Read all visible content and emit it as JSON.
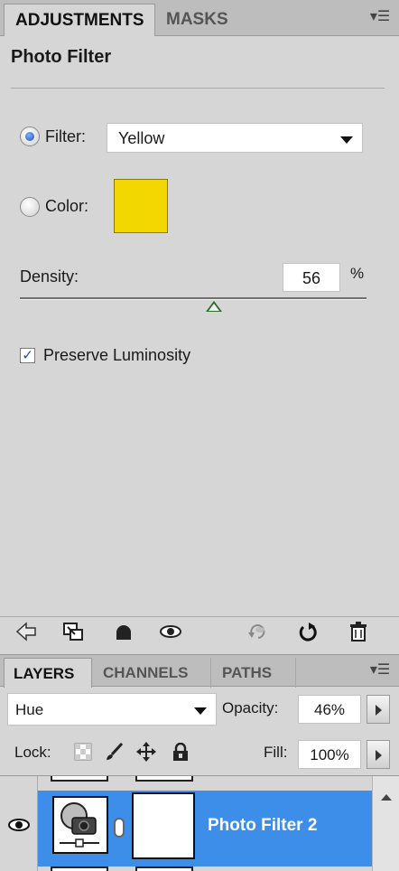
{
  "adjustments_panel": {
    "tabs": [
      {
        "label": "ADJUSTMENTS",
        "active": true
      },
      {
        "label": "MASKS",
        "active": false
      }
    ],
    "menu_icon": "panel-menu-icon",
    "title": "Photo Filter",
    "filter": {
      "radio_label": "Filter:",
      "selected": true,
      "value": "Yellow"
    },
    "color": {
      "radio_label": "Color:",
      "selected": false,
      "swatch": "#f2d800"
    },
    "density": {
      "label": "Density:",
      "value": "56",
      "unit": "%",
      "fraction": 0.56
    },
    "preserve_luminosity": {
      "label": "Preserve Luminosity",
      "checked": true,
      "mark": "✓"
    },
    "bottom_toolbar": [
      "back-arrow-icon",
      "clip-to-layer-icon",
      "mask-toggle-icon",
      "visibility-eye-icon",
      "view-previous-state-icon",
      "reset-icon",
      "trash-icon"
    ]
  },
  "layers_panel": {
    "tabs": [
      {
        "label": "LAYERS",
        "active": true
      },
      {
        "label": "CHANNELS",
        "active": false
      },
      {
        "label": "PATHS",
        "active": false
      }
    ],
    "blend_mode": "Hue",
    "opacity": {
      "label": "Opacity:",
      "value": "46%"
    },
    "lock": {
      "label": "Lock:",
      "icons": [
        "lock-transparent-icon",
        "lock-image-icon",
        "lock-position-icon",
        "lock-all-icon"
      ]
    },
    "fill": {
      "label": "Fill:",
      "value": "100%"
    },
    "layers": [
      {
        "name": "Photo Filter 2",
        "selected": true,
        "visible": true
      }
    ]
  },
  "colors": {
    "panel_bg": "#d6d6d6",
    "tab_bg": "#bdbdbd",
    "selection": "#3d8ee8",
    "swatch_yellow": "#f2d800"
  }
}
